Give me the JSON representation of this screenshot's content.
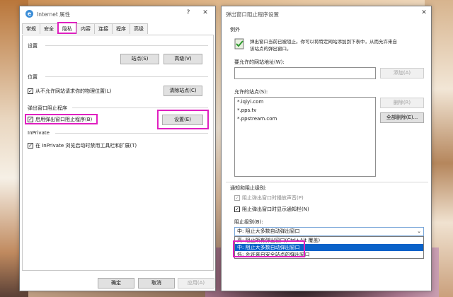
{
  "internet_props": {
    "title": "Internet 属性",
    "help_btn": "?",
    "close_btn": "✕",
    "tabs": [
      "常规",
      "安全",
      "隐私",
      "内容",
      "连接",
      "程序",
      "高级"
    ],
    "settings_group": "设置",
    "sites_btn": "站点(S)",
    "advanced_btn": "高级(V)",
    "location_group": "位置",
    "location_check": "从不允许网站请求你的物理位置(L)",
    "clear_sites_btn": "清除站点(C)",
    "popup_group": "弹出窗口阻止程序",
    "popup_check": "启用弹出窗口阻止程序(B)",
    "popup_settings_btn": "设置(E)",
    "inprivate_group": "InPrivate",
    "inprivate_check": "在 InPrivate 浏览启动时禁用工具栏和扩展(T)",
    "ok_btn": "确定",
    "cancel_btn": "取消",
    "apply_btn": "应用(A)"
  },
  "popup_dialog": {
    "title": "弹出窗口阻止程序设置",
    "close_btn": "✕",
    "exceptions_label": "例外",
    "exceptions_desc_1": "弹出窗口当前已被阻止。你可以将特定网站添加到下表中，从而允许来自",
    "exceptions_desc_2": "该站点的弹出窗口。",
    "address_label": "要允许的网站地址(W):",
    "address_value": "",
    "add_btn": "添加(A)",
    "allowed_label": "允许的站点(S):",
    "allowed_sites": [
      "*.iqiyi.com",
      "*.pps.tv",
      "*.ppstream.com"
    ],
    "remove_btn": "删除(R)",
    "remove_all_btn": "全部删除(E)...",
    "notify_label": "通知和阻止级别:",
    "sound_check": "阻止弹出窗口时播放声音(P)",
    "infobar_check": "阻止弹出窗口时显示通知栏(N)",
    "level_label": "阻止级别(B):",
    "level_selected": "中: 阻止大多数自动弹出窗口",
    "level_options": [
      "高: 阻止所有弹出窗口(Ctrl+Alt 覆盖)",
      "中: 阻止大多数自动弹出窗口",
      "低: 允许来自安全站点的弹出窗口"
    ]
  }
}
